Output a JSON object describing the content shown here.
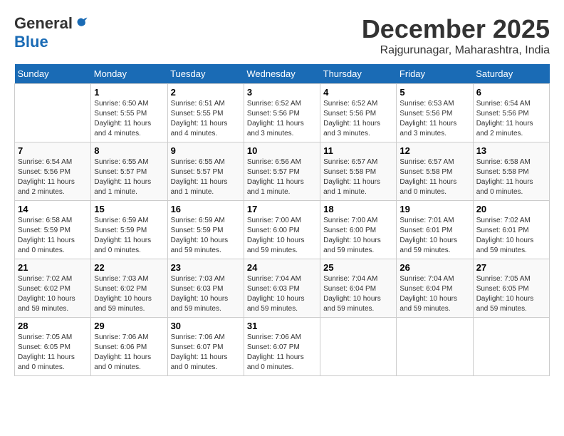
{
  "logo": {
    "general": "General",
    "blue": "Blue"
  },
  "title": {
    "month": "December 2025",
    "location": "Rajgurunagar, Maharashtra, India"
  },
  "days_of_week": [
    "Sunday",
    "Monday",
    "Tuesday",
    "Wednesday",
    "Thursday",
    "Friday",
    "Saturday"
  ],
  "weeks": [
    [
      {
        "day": null,
        "data": null
      },
      {
        "day": "1",
        "data": "Sunrise: 6:50 AM\nSunset: 5:55 PM\nDaylight: 11 hours\nand 4 minutes."
      },
      {
        "day": "2",
        "data": "Sunrise: 6:51 AM\nSunset: 5:55 PM\nDaylight: 11 hours\nand 4 minutes."
      },
      {
        "day": "3",
        "data": "Sunrise: 6:52 AM\nSunset: 5:56 PM\nDaylight: 11 hours\nand 3 minutes."
      },
      {
        "day": "4",
        "data": "Sunrise: 6:52 AM\nSunset: 5:56 PM\nDaylight: 11 hours\nand 3 minutes."
      },
      {
        "day": "5",
        "data": "Sunrise: 6:53 AM\nSunset: 5:56 PM\nDaylight: 11 hours\nand 3 minutes."
      },
      {
        "day": "6",
        "data": "Sunrise: 6:54 AM\nSunset: 5:56 PM\nDaylight: 11 hours\nand 2 minutes."
      }
    ],
    [
      {
        "day": "7",
        "data": "Sunrise: 6:54 AM\nSunset: 5:56 PM\nDaylight: 11 hours\nand 2 minutes."
      },
      {
        "day": "8",
        "data": "Sunrise: 6:55 AM\nSunset: 5:57 PM\nDaylight: 11 hours\nand 1 minute."
      },
      {
        "day": "9",
        "data": "Sunrise: 6:55 AM\nSunset: 5:57 PM\nDaylight: 11 hours\nand 1 minute."
      },
      {
        "day": "10",
        "data": "Sunrise: 6:56 AM\nSunset: 5:57 PM\nDaylight: 11 hours\nand 1 minute."
      },
      {
        "day": "11",
        "data": "Sunrise: 6:57 AM\nSunset: 5:58 PM\nDaylight: 11 hours\nand 1 minute."
      },
      {
        "day": "12",
        "data": "Sunrise: 6:57 AM\nSunset: 5:58 PM\nDaylight: 11 hours\nand 0 minutes."
      },
      {
        "day": "13",
        "data": "Sunrise: 6:58 AM\nSunset: 5:58 PM\nDaylight: 11 hours\nand 0 minutes."
      }
    ],
    [
      {
        "day": "14",
        "data": "Sunrise: 6:58 AM\nSunset: 5:59 PM\nDaylight: 11 hours\nand 0 minutes."
      },
      {
        "day": "15",
        "data": "Sunrise: 6:59 AM\nSunset: 5:59 PM\nDaylight: 11 hours\nand 0 minutes."
      },
      {
        "day": "16",
        "data": "Sunrise: 6:59 AM\nSunset: 5:59 PM\nDaylight: 10 hours\nand 59 minutes."
      },
      {
        "day": "17",
        "data": "Sunrise: 7:00 AM\nSunset: 6:00 PM\nDaylight: 10 hours\nand 59 minutes."
      },
      {
        "day": "18",
        "data": "Sunrise: 7:00 AM\nSunset: 6:00 PM\nDaylight: 10 hours\nand 59 minutes."
      },
      {
        "day": "19",
        "data": "Sunrise: 7:01 AM\nSunset: 6:01 PM\nDaylight: 10 hours\nand 59 minutes."
      },
      {
        "day": "20",
        "data": "Sunrise: 7:02 AM\nSunset: 6:01 PM\nDaylight: 10 hours\nand 59 minutes."
      }
    ],
    [
      {
        "day": "21",
        "data": "Sunrise: 7:02 AM\nSunset: 6:02 PM\nDaylight: 10 hours\nand 59 minutes."
      },
      {
        "day": "22",
        "data": "Sunrise: 7:03 AM\nSunset: 6:02 PM\nDaylight: 10 hours\nand 59 minutes."
      },
      {
        "day": "23",
        "data": "Sunrise: 7:03 AM\nSunset: 6:03 PM\nDaylight: 10 hours\nand 59 minutes."
      },
      {
        "day": "24",
        "data": "Sunrise: 7:04 AM\nSunset: 6:03 PM\nDaylight: 10 hours\nand 59 minutes."
      },
      {
        "day": "25",
        "data": "Sunrise: 7:04 AM\nSunset: 6:04 PM\nDaylight: 10 hours\nand 59 minutes."
      },
      {
        "day": "26",
        "data": "Sunrise: 7:04 AM\nSunset: 6:04 PM\nDaylight: 10 hours\nand 59 minutes."
      },
      {
        "day": "27",
        "data": "Sunrise: 7:05 AM\nSunset: 6:05 PM\nDaylight: 10 hours\nand 59 minutes."
      }
    ],
    [
      {
        "day": "28",
        "data": "Sunrise: 7:05 AM\nSunset: 6:05 PM\nDaylight: 11 hours\nand 0 minutes."
      },
      {
        "day": "29",
        "data": "Sunrise: 7:06 AM\nSunset: 6:06 PM\nDaylight: 11 hours\nand 0 minutes."
      },
      {
        "day": "30",
        "data": "Sunrise: 7:06 AM\nSunset: 6:07 PM\nDaylight: 11 hours\nand 0 minutes."
      },
      {
        "day": "31",
        "data": "Sunrise: 7:06 AM\nSunset: 6:07 PM\nDaylight: 11 hours\nand 0 minutes."
      },
      {
        "day": null,
        "data": null
      },
      {
        "day": null,
        "data": null
      },
      {
        "day": null,
        "data": null
      }
    ]
  ]
}
